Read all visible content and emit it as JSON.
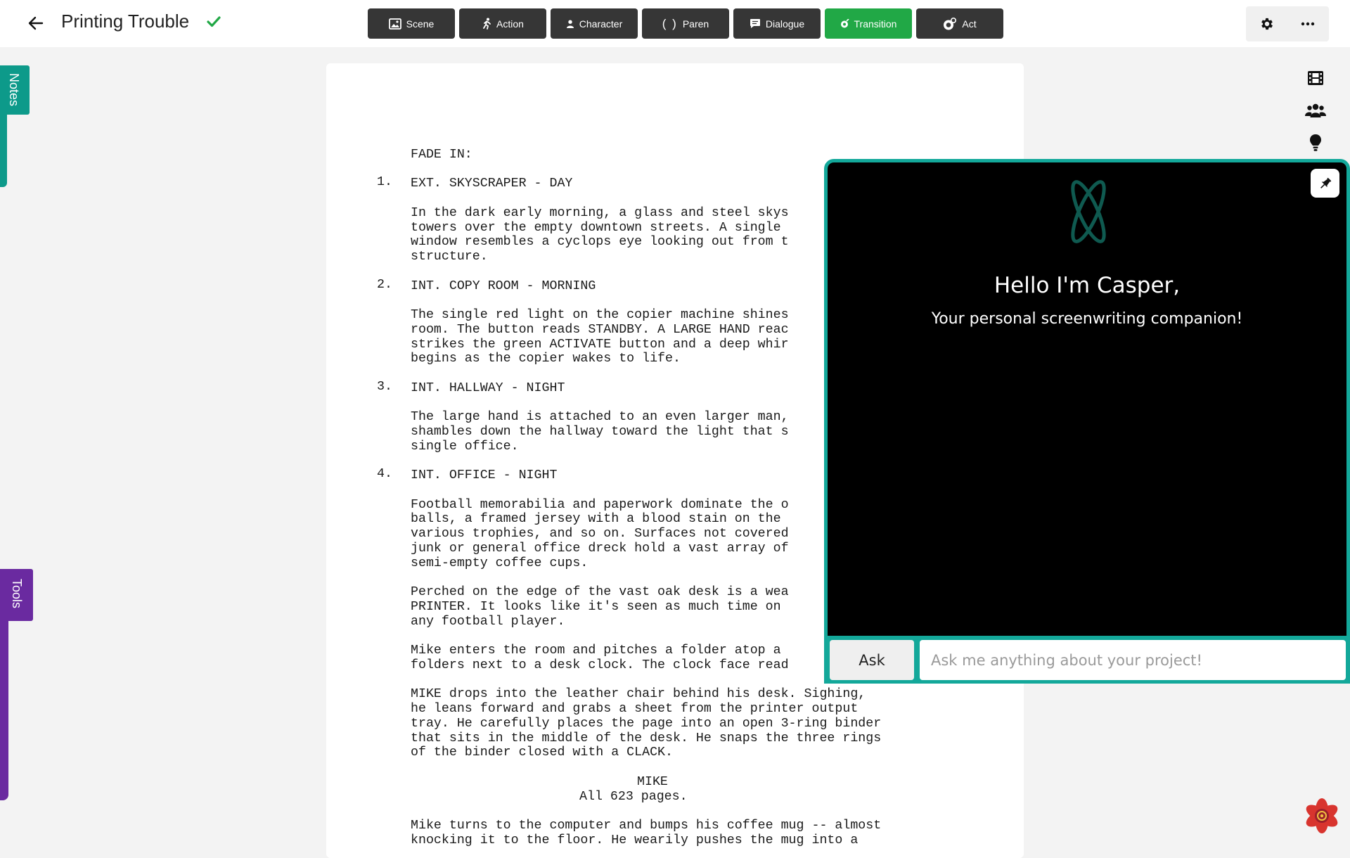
{
  "header": {
    "back_icon": "arrow-left-icon",
    "title": "Printing Trouble",
    "saved_icon": "check-icon",
    "saved_color": "#21a846"
  },
  "toolbar": {
    "buttons": [
      {
        "label": "Scene",
        "icon": "image-icon"
      },
      {
        "label": "Action",
        "icon": "running-person-icon"
      },
      {
        "label": "Character",
        "icon": "person-icon"
      },
      {
        "label": "Paren",
        "icon": "parentheses-icon"
      },
      {
        "label": "Dialogue",
        "icon": "speech-bubble-icon"
      },
      {
        "label": "Transition",
        "icon": "transition-icon",
        "active": true
      },
      {
        "label": "Act",
        "icon": "act-icon"
      }
    ],
    "active_color": "#21a846",
    "button_color": "#363636"
  },
  "top_right": {
    "settings_icon": "gear-icon",
    "more_icon": "ellipsis-icon"
  },
  "side_tabs": {
    "notes": {
      "label": "Notes",
      "color": "#0d9a8a"
    },
    "tools": {
      "label": "Tools",
      "color": "#6a2aa0"
    }
  },
  "right_rail": [
    "film-icon",
    "users-icon",
    "lightbulb-icon"
  ],
  "script": {
    "fade_in": "FADE IN:",
    "scenes": [
      {
        "number": "1.",
        "heading": "EXT. SKYSCRAPER - DAY",
        "paragraphs": [
          [
            "In the dark early morning, a glass and steel skys",
            "towers over the empty downtown streets. A single ",
            "window resembles a cyclops eye looking out from t",
            "structure."
          ]
        ]
      },
      {
        "number": "2.",
        "heading": "INT. COPY ROOM - MORNING",
        "paragraphs": [
          [
            "The single red light on the copier machine shines",
            "room. The button reads STANDBY. A LARGE HAND reac",
            "strikes the green ACTIVATE button and a deep whir",
            "begins as the copier wakes to life."
          ]
        ]
      },
      {
        "number": "3.",
        "heading": "INT. HALLWAY - NIGHT",
        "paragraphs": [
          [
            "The large hand is attached to an even larger man,",
            "shambles down the hallway toward the light that s",
            "single office."
          ]
        ]
      },
      {
        "number": "4.",
        "heading": "INT. OFFICE - NIGHT",
        "paragraphs": [
          [
            "Football memorabilia and paperwork dominate the o",
            "balls, a framed jersey with a blood stain on the ",
            "various trophies, and so on. Surfaces not covered",
            "junk or general office dreck hold a vast array of",
            "semi-empty coffee cups."
          ],
          [
            "Perched on the edge of the vast oak desk is a wea",
            "PRINTER. It looks like it's seen as much time on ",
            "any football player."
          ],
          [
            "Mike enters the room and pitches a folder atop a ",
            "folders next to a desk clock. The clock face read"
          ],
          [
            "MIKE drops into the leather chair behind his desk. Sighing,",
            "he leans forward and grabs a sheet from the printer output",
            "tray. He carefully places the page into an open 3-ring binder",
            "that sits in the middle of the desk. He snaps the three rings",
            "of the binder closed with a CLACK."
          ]
        ],
        "character": "MIKE",
        "dialogue": "All 623 pages.",
        "after": [
          "Mike turns to the computer and bumps his coffee mug -- almost",
          "knocking it to the floor. He wearily pushes the mug into a"
        ]
      }
    ]
  },
  "casper": {
    "greeting": "Hello I'm Casper,",
    "subtitle": "Your personal screenwriting companion!",
    "ask_label": "Ask",
    "input_placeholder": "Ask me anything about your project!",
    "input_value": "",
    "pin_icon": "pin-icon",
    "logo_icon": "atom-logo-icon",
    "accent": "#13a89a"
  },
  "fab_icon": "flower-badge-icon"
}
